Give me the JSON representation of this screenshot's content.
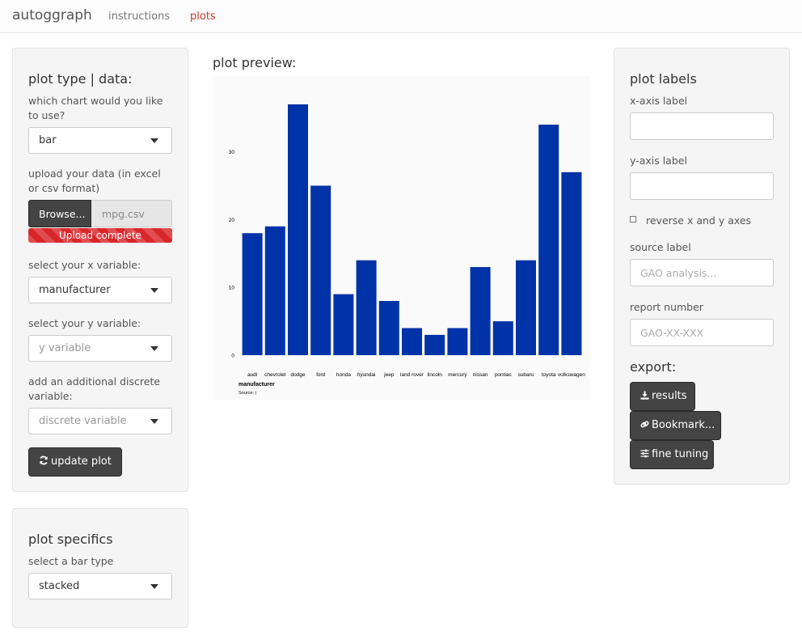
{
  "navbar": {
    "brand": "autoggraph",
    "tabs": [
      {
        "label": "instructions",
        "active": false
      },
      {
        "label": "plots",
        "active": true
      }
    ]
  },
  "left_panel": {
    "title": "plot type | data:",
    "chart_label": "which chart would you like to use?",
    "chart_value": "bar",
    "upload_label": "upload your data (in excel or csv format)",
    "browse_label": "Browse...",
    "file_name": "mpg.csv",
    "upload_status": "Upload complete",
    "upload_progress": 1.0,
    "x_label": "select your x variable:",
    "x_value": "manufacturer",
    "y_label": "select your y variable:",
    "y_placeholder": "y variable",
    "discrete_label": "add an additional discrete variable:",
    "discrete_placeholder": "discrete variable",
    "update_button": "update plot"
  },
  "specifics_panel": {
    "title": "plot specifics",
    "bar_type_label": "select a bar type",
    "bar_type_value": "stacked"
  },
  "preview": {
    "title": "plot preview:",
    "source_text": "Source:  |"
  },
  "right_panel": {
    "title": "plot labels",
    "x_axis_label": "x-axis label",
    "x_axis_value": "",
    "y_axis_label": "y-axis label",
    "y_axis_value": "",
    "reverse_label": "reverse x and y axes",
    "reverse_checked": false,
    "source_label": "source label",
    "source_placeholder": "GAO analysis...",
    "report_label": "report number",
    "report_placeholder": "GAO-XX-XXX",
    "export_title": "export:",
    "results_button": "results",
    "bookmark_button": "Bookmark...",
    "fine_tuning_button": "fine tuning"
  },
  "colors": {
    "accent": "#c0392b",
    "bar_fill": "#0032a8",
    "progress": "#d9262a",
    "button": "#444444"
  },
  "chart_data": {
    "type": "bar",
    "categories": [
      "audi",
      "chevrolet",
      "dodge",
      "ford",
      "honda",
      "hyundai",
      "jeep",
      "land rover",
      "lincoln",
      "mercury",
      "nissan",
      "pontiac",
      "subaru",
      "toyota",
      "volkswagen"
    ],
    "values": [
      18,
      19,
      37,
      25,
      9,
      14,
      8,
      4,
      3,
      4,
      13,
      5,
      14,
      34,
      27
    ],
    "yticks": [
      0,
      10,
      20,
      30
    ],
    "ylim": [
      0,
      37
    ],
    "xlabel": "manufacturer",
    "ylabel": "",
    "grid": false
  }
}
